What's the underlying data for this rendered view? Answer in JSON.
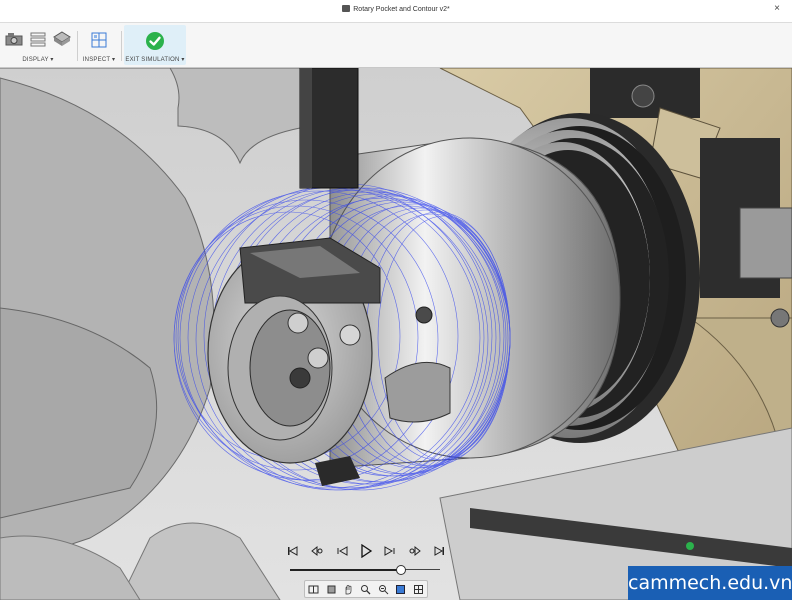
{
  "window": {
    "title": "Rotary Pocket and Contour v2*",
    "close_glyph": "×"
  },
  "toolbar": {
    "display_label": "DISPLAY ▾",
    "inspect_label": "INSPECT ▾",
    "exit_label": "EXIT SIMULATION ▾",
    "icons": [
      "camera-display-icon",
      "stock-display-icon",
      "material-display-icon",
      "inspect-ruler-icon",
      "exit-check-icon"
    ],
    "accent": "#2bb24c",
    "exit_bg": "#dfeff8"
  },
  "playback": {
    "buttons": [
      "skip-start-icon",
      "step-back-icon",
      "rewind-icon",
      "play-icon",
      "forward-icon",
      "step-forward-icon",
      "skip-end-icon"
    ],
    "progress": 0.74
  },
  "navigation": {
    "tools": [
      "orbit-icon",
      "look-at-icon",
      "pan-icon",
      "zoom-icon",
      "fit-icon",
      "display-style-icon",
      "grid-icon"
    ]
  },
  "colors": {
    "toolpath": "#3344ee",
    "fixture": "#c9b893",
    "part": "#c8c8c8"
  },
  "watermark": {
    "text": "cammech.edu.vn",
    "bg": "#1a5fb4"
  }
}
